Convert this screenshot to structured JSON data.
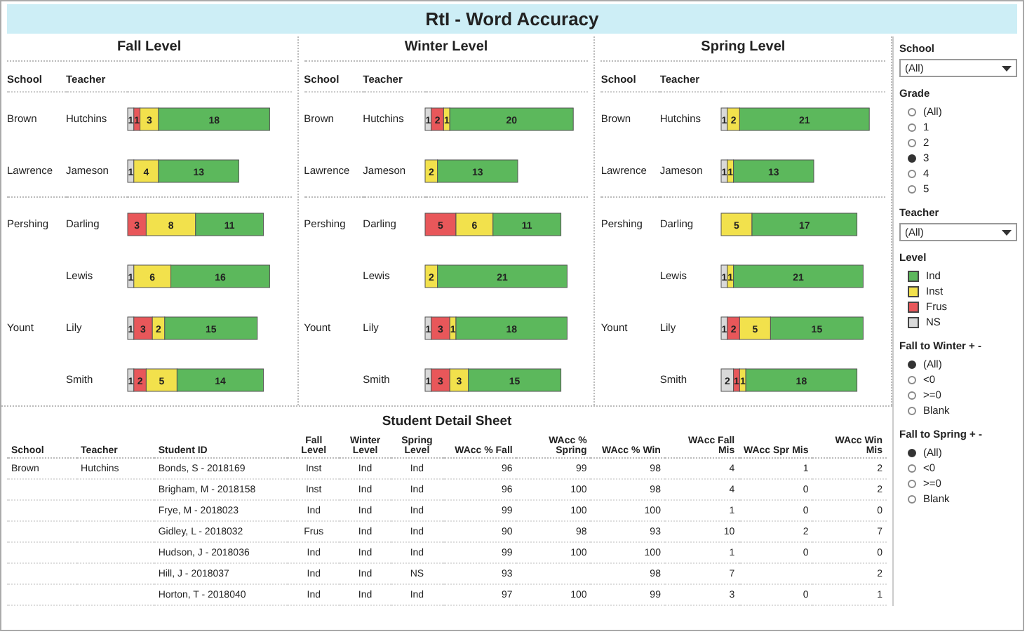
{
  "title": "RtI - Word Accuracy",
  "panels": [
    {
      "title": "Fall Level",
      "headers": [
        "School",
        "Teacher"
      ],
      "schools": [
        {
          "name": "Brown",
          "teachers": [
            "Hutchins"
          ]
        },
        {
          "name": "Lawrence",
          "teachers": [
            "Jameson"
          ]
        },
        {
          "name": "Pershing",
          "teachers": [
            "Darling",
            "Lewis"
          ]
        },
        {
          "name": "Yount",
          "teachers": [
            "Lily",
            "Smith"
          ]
        }
      ],
      "chart_data": {
        "type": "bar",
        "orientation": "horizontal",
        "stacked": true,
        "data_labels": true,
        "series": [
          {
            "name": "NS",
            "color": "#d9d9d9",
            "values": [
              1,
              1,
              null,
              1,
              1,
              1
            ]
          },
          {
            "name": "Frus",
            "color": "#e8575a",
            "values": [
              1,
              null,
              3,
              null,
              3,
              2
            ]
          },
          {
            "name": "Inst",
            "color": "#f2e14c",
            "values": [
              3,
              4,
              8,
              6,
              2,
              5
            ]
          },
          {
            "name": "Ind",
            "color": "#5cb85c",
            "values": [
              18,
              13,
              11,
              16,
              15,
              14
            ]
          }
        ]
      }
    },
    {
      "title": "Winter Level",
      "headers": [
        "School",
        "Teacher"
      ],
      "schools": [
        {
          "name": "Brown",
          "teachers": [
            "Hutchins"
          ]
        },
        {
          "name": "Lawrence",
          "teachers": [
            "Jameson"
          ]
        },
        {
          "name": "Pershing",
          "teachers": [
            "Darling",
            "Lewis"
          ]
        },
        {
          "name": "Yount",
          "teachers": [
            "Lily",
            "Smith"
          ]
        }
      ],
      "chart_data": {
        "type": "bar",
        "orientation": "horizontal",
        "stacked": true,
        "data_labels": true,
        "series": [
          {
            "color": "#d9d9d9",
            "values": [
              1,
              null,
              null,
              null,
              1,
              1
            ]
          },
          {
            "color": "#e8575a",
            "values": [
              2,
              null,
              5,
              null,
              3,
              3
            ]
          },
          {
            "color": "#f2e14c",
            "values": [
              1,
              2,
              6,
              2,
              1,
              3
            ]
          },
          {
            "color": "#5cb85c",
            "values": [
              20,
              13,
              11,
              21,
              18,
              15
            ]
          }
        ]
      }
    },
    {
      "title": "Spring Level",
      "headers": [
        "School",
        "Teacher"
      ],
      "schools": [
        {
          "name": "Brown",
          "teachers": [
            "Hutchins"
          ]
        },
        {
          "name": "Lawrence",
          "teachers": [
            "Jameson"
          ]
        },
        {
          "name": "Pershing",
          "teachers": [
            "Darling",
            "Lewis"
          ]
        },
        {
          "name": "Yount",
          "teachers": [
            "Lily",
            "Smith"
          ]
        }
      ],
      "chart_data": {
        "type": "bar",
        "orientation": "horizontal",
        "stacked": true,
        "data_labels": true,
        "series": [
          {
            "color": "#d9d9d9",
            "values": [
              1,
              1,
              null,
              1,
              1,
              2
            ]
          },
          {
            "color": "#e8575a",
            "values": [
              null,
              null,
              null,
              null,
              2,
              1
            ]
          },
          {
            "color": "#f2e14c",
            "values": [
              2,
              1,
              5,
              1,
              5,
              1
            ]
          },
          {
            "color": "#5cb85c",
            "values": [
              21,
              13,
              17,
              21,
              15,
              18
            ]
          }
        ]
      }
    }
  ],
  "table": {
    "title": "Student Detail Sheet",
    "columns": [
      "School",
      "Teacher",
      "Student ID",
      "Fall Level",
      "Winter Level",
      "Spring Level",
      "WAcc % Fall",
      "WAcc % Spring",
      "WAcc % Win",
      "WAcc Fall Mis",
      "WAcc Spr Mis",
      "WAcc Win Mis"
    ],
    "rows": [
      [
        "Brown",
        "Hutchins",
        "Bonds, S - 2018169",
        "Inst",
        "Ind",
        "Ind",
        "96",
        "99",
        "98",
        "4",
        "1",
        "2"
      ],
      [
        "",
        "",
        "Brigham, M - 2018158",
        "Inst",
        "Ind",
        "Ind",
        "96",
        "100",
        "98",
        "4",
        "0",
        "2"
      ],
      [
        "",
        "",
        "Frye, M - 2018023",
        "Ind",
        "Ind",
        "Ind",
        "99",
        "100",
        "100",
        "1",
        "0",
        "0"
      ],
      [
        "",
        "",
        "Gidley, L - 2018032",
        "Frus",
        "Ind",
        "Ind",
        "90",
        "98",
        "93",
        "10",
        "2",
        "7"
      ],
      [
        "",
        "",
        "Hudson, J - 2018036",
        "Ind",
        "Ind",
        "Ind",
        "99",
        "100",
        "100",
        "1",
        "0",
        "0"
      ],
      [
        "",
        "",
        "Hill, J - 2018037",
        "Ind",
        "Ind",
        "NS",
        "93",
        "",
        "98",
        "7",
        "",
        "2"
      ],
      [
        "",
        "",
        "Horton, T - 2018040",
        "Ind",
        "Ind",
        "Ind",
        "97",
        "100",
        "99",
        "3",
        "0",
        "1"
      ]
    ]
  },
  "sidebar": [
    {
      "kind": "dropdown",
      "label": "School",
      "value": "(All)"
    },
    {
      "kind": "radio",
      "label": "Grade",
      "options": [
        {
          "label": "(All)",
          "selected": false
        },
        {
          "label": "1",
          "selected": false
        },
        {
          "label": "2",
          "selected": false
        },
        {
          "label": "3",
          "selected": true
        },
        {
          "label": "4",
          "selected": false
        },
        {
          "label": "5",
          "selected": false
        }
      ]
    },
    {
      "kind": "dropdown",
      "label": "Teacher",
      "value": "(All)"
    },
    {
      "kind": "legend",
      "label": "Level"
    },
    {
      "kind": "radio",
      "label": "Fall to Winter + -",
      "options": [
        {
          "label": "(All)",
          "selected": true
        },
        {
          "label": "<0",
          "selected": false
        },
        {
          "label": ">=0",
          "selected": false
        },
        {
          "label": "Blank",
          "selected": false
        }
      ]
    },
    {
      "kind": "radio",
      "label": "Fall to Spring + -",
      "options": [
        {
          "label": "(All)",
          "selected": true
        },
        {
          "label": "<0",
          "selected": false
        },
        {
          "label": ">=0",
          "selected": false
        },
        {
          "label": "Blank",
          "selected": false
        }
      ]
    }
  ]
}
